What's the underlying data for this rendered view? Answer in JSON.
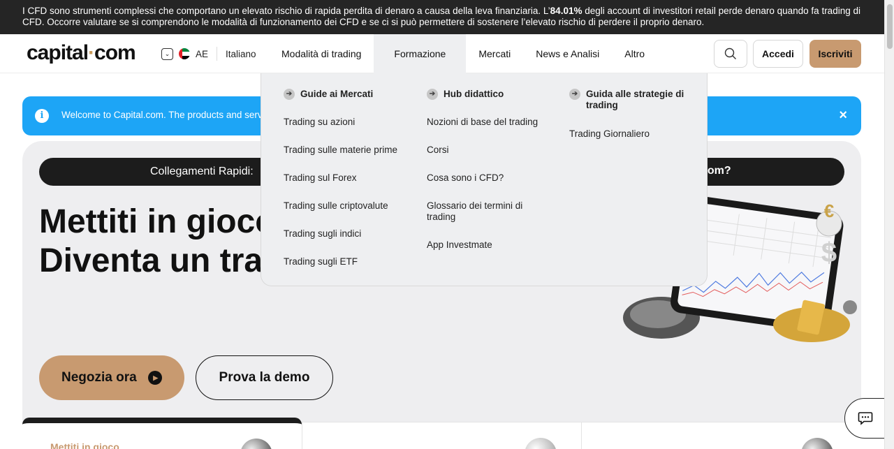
{
  "risk_warning": {
    "text_before": "I CFD sono strumenti complessi che comportano un elevato rischio di rapida perdita di denaro a causa della leva finanziaria. L’",
    "percent": "84.01%",
    "text_after": " degli account di investitori retail perde denaro quando fa trading di CFD. Occorre valutare se si comprendono le modalità di funzionamento dei CFD e se ci si può permettere di sostenere l’elevato rischio di perdere il proprio denaro."
  },
  "header": {
    "logo_left": "capital",
    "logo_dot": "·",
    "logo_right": "com",
    "region": "AE",
    "language": "Italiano",
    "nav": [
      "Modalità di trading",
      "Formazione",
      "Mercati",
      "News e Analisi",
      "Altro"
    ],
    "login": "Accedi",
    "signup": "Iscriviti"
  },
  "welcome": {
    "info_glyph": "i",
    "message": "Welcome to Capital.com. The products and serv",
    "close_glyph": "×"
  },
  "hero": {
    "quick_links_label": "Collegamenti Rapidi:",
    "quick_links_tail": "com?",
    "title_line1": "Mettiti in gioco",
    "title_line2": "Diventa un tra",
    "cta_trade": "Negozia ora",
    "cta_demo": "Prova la demo"
  },
  "cards": {
    "first_title": "Mettiti in gioco"
  },
  "dropdown": {
    "columns": [
      {
        "heading": "Guide ai Mercati",
        "items": [
          "Trading su azioni",
          "Trading sulle materie prime",
          "Trading sul Forex",
          "Trading sulle criptovalute",
          "Trading sugli indici",
          "Trading sugli ETF"
        ]
      },
      {
        "heading": "Hub didattico",
        "items": [
          "Nozioni di base del trading",
          "Corsi",
          "Cosa sono i CFD?",
          "Glossario dei termini di trading",
          "App Investmate"
        ]
      },
      {
        "heading": "Guida alle strategie di trading",
        "items": [
          "Trading Giornaliero"
        ]
      }
    ]
  },
  "icons": {
    "search": "search-icon",
    "chevron": "chevron-down-icon",
    "flag": "uae-flag-icon",
    "info": "info-icon",
    "close": "close-icon",
    "arrow": "arrow-right-icon",
    "play": "play-icon",
    "chat": "chat-icon"
  },
  "colors": {
    "accent": "#c89a70",
    "banner_blue": "#1da5f6",
    "dark": "#1c1c1c"
  }
}
